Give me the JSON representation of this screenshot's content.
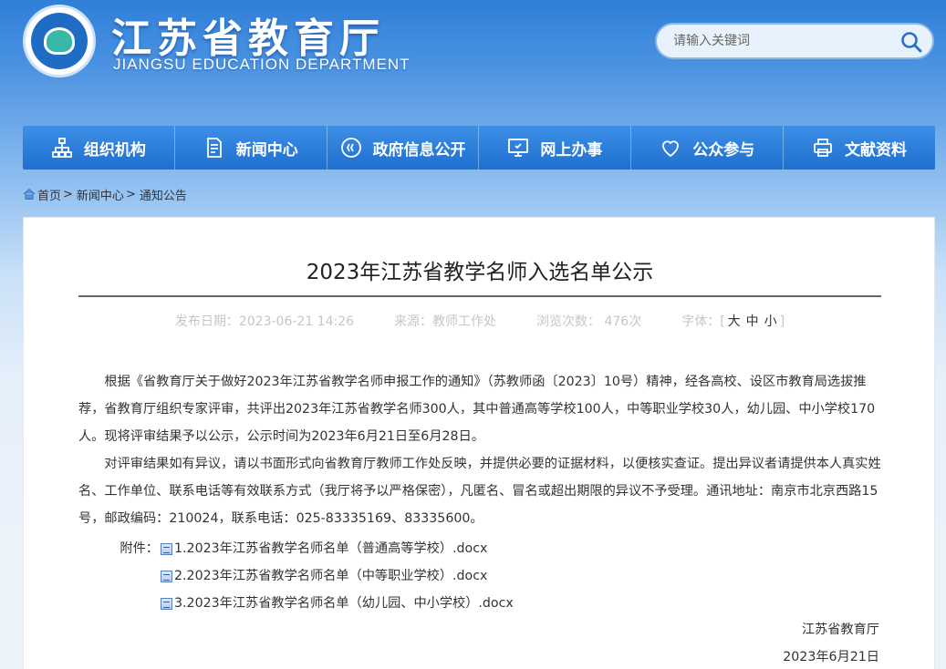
{
  "header": {
    "brand_cn": "江苏省教育厅",
    "brand_en": "JIANGSU EDUCATION DEPARTMENT",
    "search_placeholder": "请输入关键词"
  },
  "nav": {
    "items": [
      {
        "label": "组织机构",
        "icon": "org-chart-icon"
      },
      {
        "label": "新闻中心",
        "icon": "document-icon"
      },
      {
        "label": "政府信息公开",
        "icon": "play-circle-icon"
      },
      {
        "label": "网上办事",
        "icon": "monitor-icon"
      },
      {
        "label": "公众参与",
        "icon": "heart-icon"
      },
      {
        "label": "文献资料",
        "icon": "printer-icon"
      }
    ]
  },
  "breadcrumb": {
    "items": [
      "首页",
      "新闻中心",
      "通知公告"
    ]
  },
  "article": {
    "title": "2023年江苏省教学名师入选名单公示",
    "publish_date": "发布日期：2023-06-21 14:26",
    "source": "来源：教师工作处",
    "views": "浏览次数： 476次",
    "font_label": "字体：[",
    "font_close": "]",
    "font_sizes": [
      "大",
      "中",
      "小"
    ],
    "paragraphs": [
      "根据《省教育厅关于做好2023年江苏省教学名师申报工作的通知》（苏教师函〔2023〕10号）精神，经各高校、设区市教育局选拔推荐，省教育厅组织专家评审，共评出2023年江苏省教学名师300人，其中普通高等学校100人，中等职业学校30人，幼儿园、中小学校170人。现将评审结果予以公示，公示时间为2023年6月21日至6月28日。",
      "对评审结果如有异议，请以书面形式向省教育厅教师工作处反映，并提供必要的证据材料，以便核实查证。提出异议者请提供本人真实姓名、工作单位、联系电话等有效联系方式（我厅将予以严格保密），凡匿名、冒名或超出期限的异议不予受理。通讯地址：南京市北京西路15号，邮政编码：210024，联系电话：025-83335169、83335600。"
    ],
    "attachments_label": "附件：",
    "attachments": [
      "1.2023年江苏省教学名师名单（普通高等学校）.docx",
      "2.2023年江苏省教学名师名单（中等职业学校）.docx",
      "3.2023年江苏省教学名师名单（幼儿园、中小学校）.docx"
    ],
    "signature": "江苏省教育厅",
    "sign_date": "2023年6月21日"
  }
}
